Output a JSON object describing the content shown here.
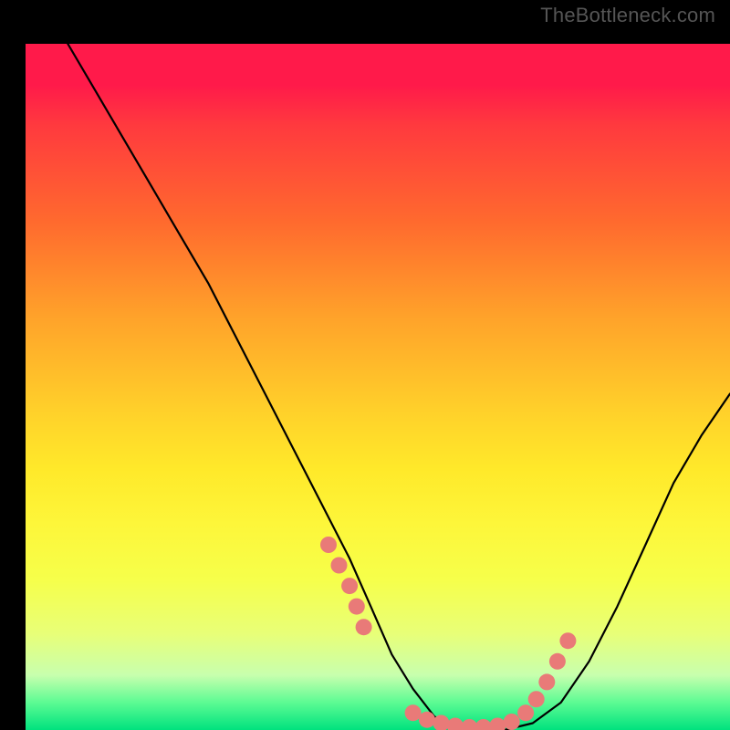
{
  "watermark": {
    "text": "TheBottleneck.com"
  },
  "colors": {
    "curve": "#000000",
    "marker": "#e97a78",
    "bg_top": "#ff1a4a",
    "bg_bottom": "#00e27e"
  },
  "chart_data": {
    "type": "line",
    "title": "",
    "xlabel": "",
    "ylabel": "",
    "xlim": [
      0,
      100
    ],
    "ylim": [
      0,
      100
    ],
    "grid": false,
    "legend": false,
    "series": [
      {
        "name": "bottleneck-curve",
        "x": [
          6,
          10,
          14,
          18,
          22,
          26,
          30,
          34,
          38,
          42,
          46,
          49,
          52,
          55,
          58,
          61,
          64,
          68,
          72,
          76,
          80,
          84,
          88,
          92,
          96,
          100
        ],
        "y": [
          100,
          93,
          86,
          79,
          72,
          65,
          57,
          49,
          41,
          33,
          25,
          18,
          11,
          6,
          2,
          0,
          0,
          0,
          1,
          4,
          10,
          18,
          27,
          36,
          43,
          49
        ]
      }
    ],
    "markers": {
      "name": "highlight-points",
      "x": [
        43,
        44.5,
        46,
        47,
        48,
        55,
        57,
        59,
        61,
        63,
        65,
        67,
        69,
        71,
        72.5,
        74,
        75.5,
        77
      ],
      "y": [
        27,
        24,
        21,
        18,
        15,
        2.5,
        1.5,
        1,
        0.6,
        0.4,
        0.4,
        0.6,
        1.2,
        2.5,
        4.5,
        7,
        10,
        13
      ]
    }
  }
}
